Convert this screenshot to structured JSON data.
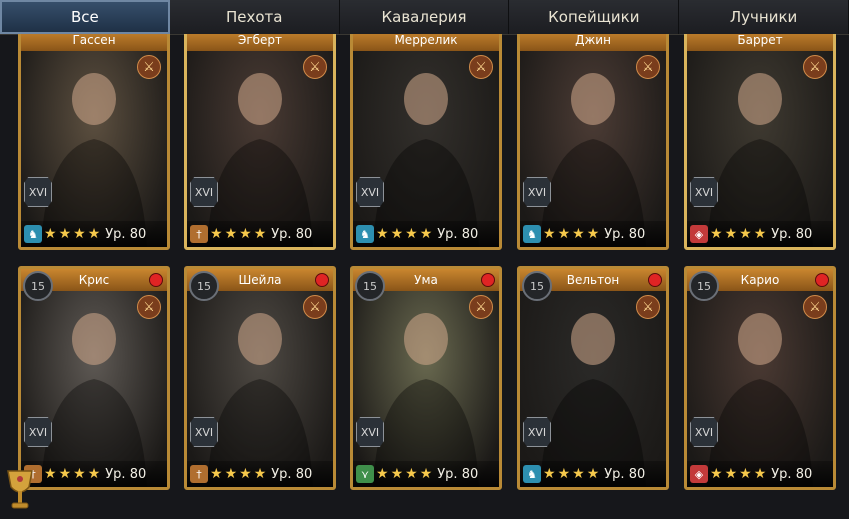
{
  "tabs": [
    {
      "label": "Все",
      "active": true
    },
    {
      "label": "Пехота",
      "active": false
    },
    {
      "label": "Кавалерия",
      "active": false
    },
    {
      "label": "Копейщики",
      "active": false
    },
    {
      "label": "Лучники",
      "active": false
    }
  ],
  "heroes": [
    {
      "name": "Гассен",
      "rank": "XVI",
      "level_label": "Ур. 80",
      "stars": 4,
      "type": "cavalry",
      "type_icon": "horse-icon",
      "type_color": "#2d8fb0",
      "weapon_icon": "sword-icon",
      "medal": "",
      "alert": false,
      "bg": "#5d5040"
    },
    {
      "name": "Эгберт",
      "rank": "XVI",
      "level_label": "Ур. 80",
      "stars": 4,
      "type": "infantry",
      "type_icon": "sword-icon",
      "type_color": "#b06e2f",
      "weapon_icon": "sword-icon",
      "medal": "",
      "alert": false,
      "bg": "#4a3b34"
    },
    {
      "name": "Меррелик",
      "rank": "XVI",
      "level_label": "Ур. 80",
      "stars": 4,
      "type": "cavalry",
      "type_icon": "horse-icon",
      "type_color": "#2d8fb0",
      "weapon_icon": "sword-icon",
      "medal": "",
      "alert": false,
      "bg": "#33302c"
    },
    {
      "name": "Джин",
      "rank": "XVI",
      "level_label": "Ур. 80",
      "stars": 4,
      "type": "cavalry",
      "type_icon": "horse-icon",
      "type_color": "#2d8fb0",
      "weapon_icon": "sword-icon",
      "medal": "",
      "alert": false,
      "bg": "#4c3c35"
    },
    {
      "name": "Баррет",
      "rank": "XVI",
      "level_label": "Ур. 80",
      "stars": 4,
      "type": "pikemen",
      "type_icon": "shield-icon",
      "type_color": "#c33a3a",
      "weapon_icon": "sword-icon",
      "medal": "",
      "alert": false,
      "bg": "#3f3a31"
    },
    {
      "name": "Крис",
      "rank": "XVI",
      "level_label": "Ур. 80",
      "stars": 4,
      "type": "infantry",
      "type_icon": "sword-icon",
      "type_color": "#b06e2f",
      "weapon_icon": "sword-icon",
      "medal": "15",
      "alert": true,
      "bg": "#5f5a55"
    },
    {
      "name": "Шейла",
      "rank": "XVI",
      "level_label": "Ур. 80",
      "stars": 4,
      "type": "infantry",
      "type_icon": "sword-icon",
      "type_color": "#b06e2f",
      "weapon_icon": "sword-icon",
      "medal": "15",
      "alert": true,
      "bg": "#4f4a44"
    },
    {
      "name": "Ума",
      "rank": "XVI",
      "level_label": "Ур. 80",
      "stars": 4,
      "type": "archer",
      "type_icon": "arrows-icon",
      "type_color": "#3f8f4b",
      "weapon_icon": "sword-icon",
      "medal": "15",
      "alert": true,
      "bg": "#6a6a50"
    },
    {
      "name": "Вельтон",
      "rank": "XVI",
      "level_label": "Ур. 80",
      "stars": 4,
      "type": "cavalry",
      "type_icon": "horse-icon",
      "type_color": "#2d8fb0",
      "weapon_icon": "sword-icon",
      "medal": "15",
      "alert": true,
      "bg": "#2b2a28"
    },
    {
      "name": "Карио",
      "rank": "XVI",
      "level_label": "Ур. 80",
      "stars": 4,
      "type": "pikemen",
      "type_icon": "shield-icon",
      "type_color": "#c33a3a",
      "weapon_icon": "sword-icon",
      "medal": "15",
      "alert": true,
      "bg": "#4b3a33"
    }
  ]
}
